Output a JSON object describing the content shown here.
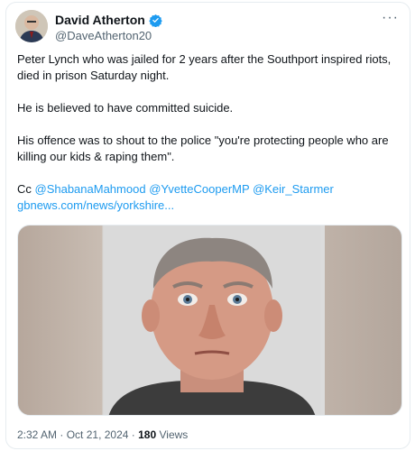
{
  "author": {
    "name": "David Atherton",
    "handle": "@DaveAtherton20"
  },
  "menu_label": "···",
  "paragraphs": [
    "Peter Lynch who was jailed for 2 years after the Southport inspired riots, died in prison Saturday night.",
    "He is believed to have committed suicide.",
    "His offence was to shout to the police \"you're protecting people who are killing our kids & raping them\"."
  ],
  "cc_prefix": "Cc ",
  "mentions": [
    "@ShabanaMahmood",
    "@YvetteCooperMP",
    "@Keir_Starmer"
  ],
  "link": "gbnews.com/news/yorkshire...",
  "meta": {
    "time": "2:32 AM",
    "date": "Oct 21, 2024",
    "views_count": "180",
    "views_label": "Views",
    "separator": "·"
  },
  "colors": {
    "accent": "#1d9bf0",
    "text": "#0f1419",
    "secondary": "#536471"
  },
  "icons": {
    "verified": "verified-badge-icon",
    "more": "more-horizontal-icon"
  }
}
